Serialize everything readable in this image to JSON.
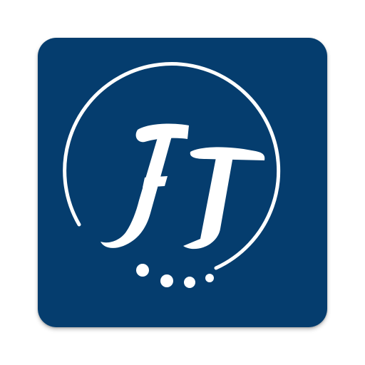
{
  "app_icon": {
    "name": "FT",
    "logo_monogram": "FT",
    "icon": "ft-monogram-logo-icon",
    "colors": {
      "tile": "#053d6e",
      "mark": "#ffffff"
    }
  }
}
